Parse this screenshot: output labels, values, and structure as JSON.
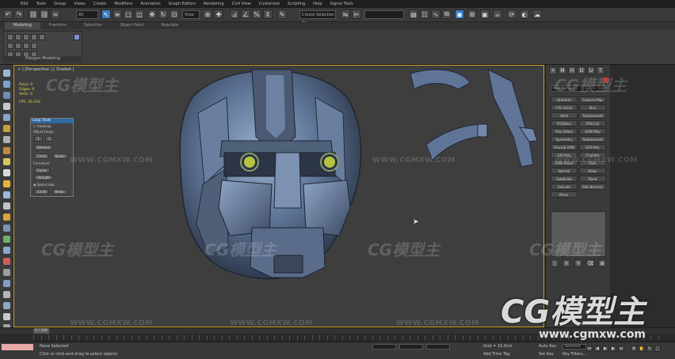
{
  "menubar": {
    "items": [
      "Edit",
      "Tools",
      "Group",
      "Views",
      "Create",
      "Modifiers",
      "Animation",
      "Graph Editors",
      "Rendering",
      "Civil View",
      "Customize",
      "Scripting",
      "Help",
      "Signal Tools"
    ]
  },
  "toolbar": {
    "filter_value": "All",
    "view_value": "View",
    "selection_set_placeholder": "Create Selection Se"
  },
  "ribbon": {
    "tabs": [
      "Modeling",
      "Freeform",
      "Selection",
      "Object Paint",
      "Populate"
    ],
    "active_tab": "Modeling",
    "group_label": "Polygon Modeling"
  },
  "viewport": {
    "label": "+ ] [Perspective ] [ Shaded ]",
    "stats": {
      "polys_label": "Polys: 0",
      "edges_label": "Edges: 0",
      "verts_label": "Verts: 0",
      "fps_label": "FPS: 56.359"
    }
  },
  "looptools": {
    "title": "Loop Tools",
    "autoloop": "Autoloop",
    "adjust_loops": "Adjust Loops",
    "values": [
      "1",
      "1"
    ],
    "buttons": [
      "Remove",
      "Circle",
      "Spline",
      "Curve",
      "Straight",
      "Space loop",
      "Circle",
      "Relax"
    ],
    "section_label": "Curvature"
  },
  "command_panel": {
    "tabs": [
      "+",
      "M",
      "H",
      "D",
      "U",
      "T"
    ],
    "dropdown_value": "Modifier List",
    "buttons": [
      "Optimize",
      "Camera Map",
      "FFD 2x2x2",
      "Skin",
      "Shell",
      "Turbosmooth",
      "FFD(Box)",
      "FFD(Cyl)",
      "Poly Select",
      "UVW Map",
      "Symmetry",
      "Turbosmooth",
      "Unwrap UVW",
      "Edit Poly",
      "Edit Poly",
      "Chamfer",
      "UVW Xform",
      "Push",
      "Normal",
      "Relax",
      "Subdivide",
      "Bend",
      "Extrude",
      "Edit Normals",
      "Mirror"
    ],
    "footer_buttons": [
      "|",
      "II",
      "∀",
      "⌫",
      "⊞"
    ]
  },
  "timeline": {
    "slider_label": "0 / 100"
  },
  "status_bar": {
    "selection_text": "None Selected",
    "prompt_text": "Click or click-and-drag to select objects",
    "grid_label": "Grid = 10.0cm",
    "add_time_tag": "Add Time Tag",
    "auto_key": "Auto Key",
    "set_key": "Set Key",
    "key_filters": "Key Filters...",
    "selected_value": "Selected"
  },
  "watermarks": {
    "small_brand": "CG模型主",
    "small_url": "WWW.CGMXW.COM",
    "big_brand": "CG模型主",
    "big_url": "www.cgmxw.com"
  },
  "colors": {
    "viewport_border": "#c8a02a",
    "active_blue": "#3b7fc4",
    "stats_yellow": "#e6d34a",
    "model_blue": "#5d7395"
  }
}
